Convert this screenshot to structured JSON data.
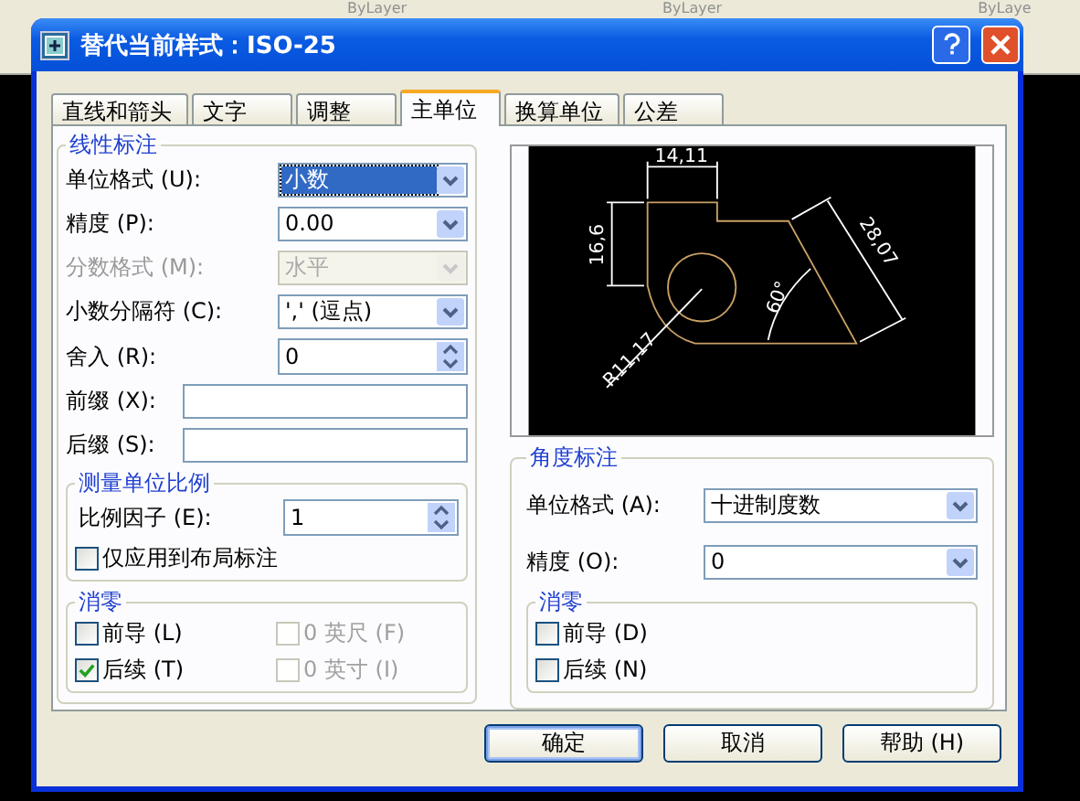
{
  "background": {
    "toolbar_texts": [
      "ByLayer",
      "ByLayer",
      "ByLaye"
    ]
  },
  "window": {
    "title": "替代当前样式：ISO-25"
  },
  "tabs": [
    {
      "label": "直线和箭头",
      "selected": false
    },
    {
      "label": "文字",
      "selected": false
    },
    {
      "label": "调整",
      "selected": false
    },
    {
      "label": "主单位",
      "selected": true
    },
    {
      "label": "换算单位",
      "selected": false
    },
    {
      "label": "公差",
      "selected": false
    }
  ],
  "linear": {
    "title": "线性标注",
    "fields": [
      {
        "kind": "dropdown",
        "label": "单位格式 (U):",
        "value": "小数",
        "highlighted": true,
        "disabled": false
      },
      {
        "kind": "dropdown",
        "label": "精度 (P):",
        "value": "0.00",
        "highlighted": false,
        "disabled": false
      },
      {
        "kind": "dropdown",
        "label": "分数格式 (M):",
        "value": "水平",
        "highlighted": false,
        "disabled": true
      },
      {
        "kind": "dropdown",
        "label": "小数分隔符 (C):",
        "value": "',' (逗点)",
        "highlighted": false,
        "disabled": false
      },
      {
        "kind": "spin",
        "label": "舍入 (R):",
        "value": "0"
      },
      {
        "kind": "text",
        "label": "前缀 (X):"
      },
      {
        "kind": "text",
        "label": "后缀 (S):"
      }
    ],
    "scale": {
      "title": "测量单位比例",
      "factor": {
        "label": "比例因子 (E):",
        "value": "1"
      },
      "layout_only": {
        "label": "仅应用到布局标注",
        "checked": false
      }
    },
    "zero": {
      "title": "消零",
      "options": [
        {
          "label": "前导 (L)",
          "checked": false,
          "disabled": false
        },
        {
          "label": "0 英尺 (F)",
          "checked": false,
          "disabled": true
        },
        {
          "label": "后续 (T)",
          "checked": true,
          "disabled": false
        },
        {
          "label": "0 英寸 (I)",
          "checked": false,
          "disabled": true
        }
      ]
    }
  },
  "preview": {
    "labels": [
      "14,11",
      "16,6",
      "28,07",
      "60°",
      "R11,17"
    ]
  },
  "angular": {
    "title": "角度标注",
    "fields": [
      {
        "label": "单位格式 (A):",
        "value": "十进制度数"
      },
      {
        "label": "精度 (O):",
        "value": "0"
      }
    ],
    "zero": {
      "title": "消零",
      "options": [
        {
          "label": "前导 (D)",
          "checked": false,
          "disabled": false
        },
        {
          "label": "后续 (N)",
          "checked": false,
          "disabled": false
        }
      ]
    }
  },
  "buttons": [
    {
      "label": "确定",
      "default": true
    },
    {
      "label": "取消",
      "default": false
    },
    {
      "label": "帮助 (H)",
      "default": false
    }
  ]
}
